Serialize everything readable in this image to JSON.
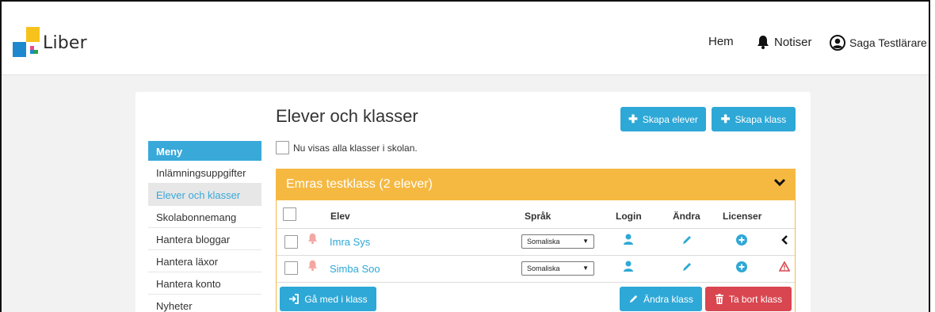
{
  "header": {
    "logo_text": "Liber",
    "nav": {
      "home": "Hem",
      "notifications": "Notiser",
      "user": "Saga Testlärare"
    }
  },
  "page": {
    "title": "Elever och klasser",
    "create_students_label": "Skapa elever",
    "create_class_label": "Skapa klass",
    "show_all_label": "Nu visas alla klasser i skolan."
  },
  "menu": {
    "heading": "Meny",
    "items": [
      {
        "label": "Inlämningsuppgifter"
      },
      {
        "label": "Elever och klasser"
      },
      {
        "label": "Skolabonnemang"
      },
      {
        "label": "Hantera bloggar"
      },
      {
        "label": "Hantera läxor"
      },
      {
        "label": "Hantera konto"
      },
      {
        "label": "Nyheter"
      }
    ],
    "active_item": "Elever och klasser"
  },
  "class_panel": {
    "title": "Emras testklass (2 elever)",
    "columns": {
      "student": "Elev",
      "language": "Språk",
      "login": "Login",
      "edit": "Ändra",
      "licenses": "Licenser"
    },
    "students": [
      {
        "name": "Imra Sys",
        "language": "Somaliska",
        "status_icon": "chevron-left-icon"
      },
      {
        "name": "Simba Soo",
        "language": "Somaliska",
        "status_icon": "warning-icon"
      }
    ],
    "join_class_label": "Gå med i klass",
    "edit_class_label": "Ändra klass",
    "delete_class_label": "Ta bort klass"
  },
  "colors": {
    "accent_blue": "#2ea8d6",
    "menu_blue": "#39a9d9",
    "class_header": "#f5b942",
    "danger": "#d9464f",
    "bell_inactive": "#f4a7a2",
    "logo_yellow": "#f7c21b",
    "logo_blue": "#1e88cf",
    "logo_green": "#2aa34a",
    "logo_pink": "#e84a8b"
  }
}
